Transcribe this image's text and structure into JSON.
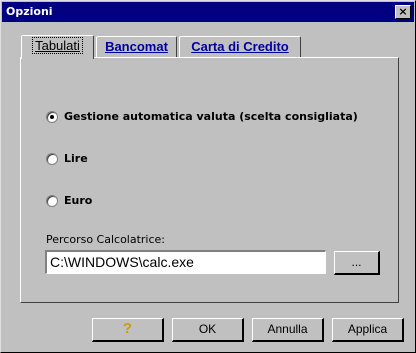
{
  "window": {
    "title": "Opzioni",
    "close_symbol": "×"
  },
  "tabs": [
    {
      "label": "Tabulati",
      "active": true
    },
    {
      "label": "Bancomat",
      "active": false
    },
    {
      "label": "Carta di Credito",
      "active": false
    }
  ],
  "options": {
    "radios": [
      {
        "label": "Gestione automatica valuta (scelta consigliata)",
        "checked": true
      },
      {
        "label": "Lire",
        "checked": false
      },
      {
        "label": "Euro",
        "checked": false
      }
    ],
    "path_label": "Percorso Calcolatrice:",
    "path_value": "C:\\WINDOWS\\calc.exe",
    "browse_label": "..."
  },
  "buttons": {
    "help_symbol": "?",
    "ok_label": "OK",
    "cancel_label": "Annulla",
    "apply_label": "Applica"
  },
  "colors": {
    "titlebar": "#000080",
    "face": "#c0c0c0",
    "tab_link": "#0000a0"
  }
}
